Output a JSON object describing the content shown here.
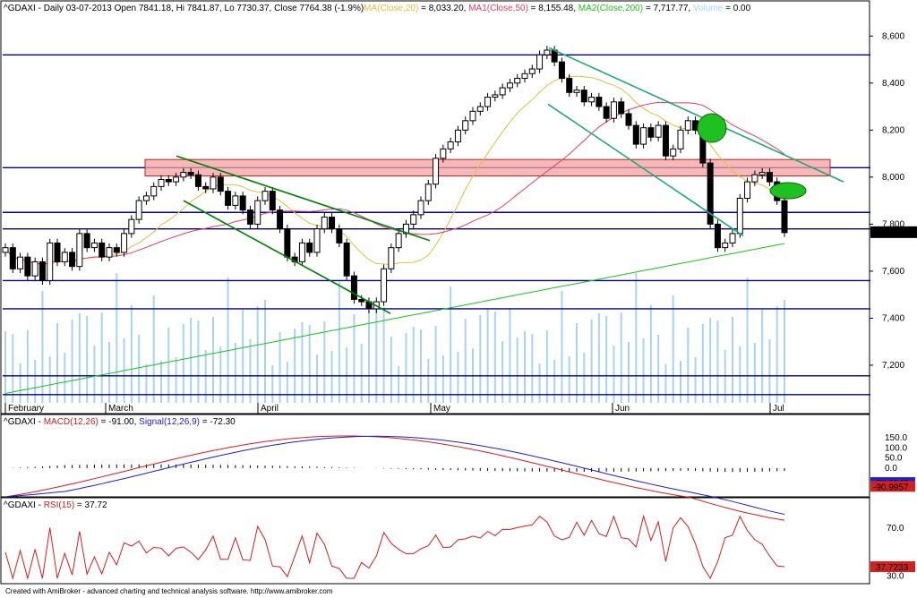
{
  "header": {
    "ticker_line": "^GDAXI - Daily 03-07-2013 Open 7841.18, Hi 7841.87, Lo 7730.37, Close 7764.38 (-1.9%)",
    "ma_label": "MA(Close,20)",
    "ma_value": " = 8,033.20, ",
    "ma1_label": "MA1(Close,50)",
    "ma1_value": " = 8,155.48, ",
    "ma2_label": "MA2(Close,200)",
    "ma2_value": " = 7,717.77, ",
    "vol_label": "Volume",
    "vol_value": " = 0.00"
  },
  "macd_header": {
    "prefix": "^GDAXI - ",
    "macd_label": "MACD(12,26)",
    "macd_value": " = -91.00, ",
    "signal_label": "Signal(12,26,9)",
    "signal_value": " = -72.30"
  },
  "rsi_header": {
    "prefix": "^GDAXI - ",
    "rsi_label": "RSI(15)",
    "rsi_value": " = 37.72"
  },
  "footer": "Created with AmiBroker - advanced charting and technical analysis software. http://www.amibroker.com",
  "colors": {
    "candle": "#000000",
    "ma20": "#e0c040",
    "ma50": "#e04060",
    "ma200": "#20c020",
    "volume": "#a8d4f0",
    "hline": "#00008b",
    "trend": "#008000",
    "trend2": "#20a878",
    "resistance_zone": "#f4a0a0",
    "green_ellipse": "#20c020",
    "macd": "#d02020",
    "signal": "#2020d0",
    "rsi": "#d02020"
  },
  "chart_data": [
    {
      "type": "candlestick",
      "title": "^GDAXI - Daily",
      "ylim": [
        7040,
        8700
      ],
      "y_ticks": [
        "8,600",
        "8,400",
        "8,200",
        "8,000",
        "7,800",
        "7,600",
        "7,400",
        "7,200"
      ],
      "x_month_labels": [
        "February",
        "March",
        "April",
        "May",
        "Jun",
        "Jul"
      ],
      "last_price_label": "7,764.38",
      "horizontal_levels": [
        8520,
        8040,
        7850,
        7780,
        7560,
        7440,
        7155,
        7075
      ],
      "resistance_zone": [
        8005,
        8075
      ],
      "close": [
        7700,
        7610,
        7660,
        7580,
        7640,
        7560,
        7720,
        7640,
        7680,
        7620,
        7760,
        7700,
        7720,
        7660,
        7700,
        7680,
        7760,
        7820,
        7900,
        7920,
        7960,
        7990,
        7980,
        8000,
        8020,
        8010,
        7960,
        7950,
        8000,
        7940,
        7880,
        7920,
        7860,
        7800,
        7900,
        7940,
        7860,
        7780,
        7660,
        7640,
        7720,
        7680,
        7780,
        7830,
        7780,
        7720,
        7580,
        7480,
        7470,
        7440,
        7470,
        7610,
        7700,
        7760,
        7800,
        7840,
        7900,
        7970,
        8080,
        8120,
        8150,
        8200,
        8240,
        8280,
        8300,
        8340,
        8350,
        8380,
        8400,
        8420,
        8440,
        8460,
        8520,
        8540,
        8490,
        8420,
        8360,
        8370,
        8320,
        8340,
        8300,
        8250,
        8320,
        8270,
        8220,
        8140,
        8210,
        8170,
        8220,
        8090,
        8120,
        8200,
        8240,
        8200,
        8060,
        7800,
        7700,
        7720,
        7760,
        7910,
        7980,
        8010,
        8020,
        7980,
        7900,
        7764
      ],
      "ma20_final": 8033.2,
      "ma50_final": 8155.48,
      "ma200_final": 7717.77
    },
    {
      "type": "line",
      "title": "MACD(12,26)",
      "ylim": [
        -130,
        200
      ],
      "y_ticks": [
        "150.0",
        "100.0",
        "50.0",
        "0.0"
      ],
      "macd_last": -90.9957,
      "signal_last": -72.3047,
      "macd_last_label": "-90.9957",
      "signal_last_label": "-72.3047"
    },
    {
      "type": "line",
      "title": "RSI(15)",
      "ylim": [
        25,
        85
      ],
      "y_ticks": [
        "70.0",
        "30.0"
      ],
      "rsi_last": 37.7233,
      "rsi_last_label": "37.7233"
    }
  ]
}
